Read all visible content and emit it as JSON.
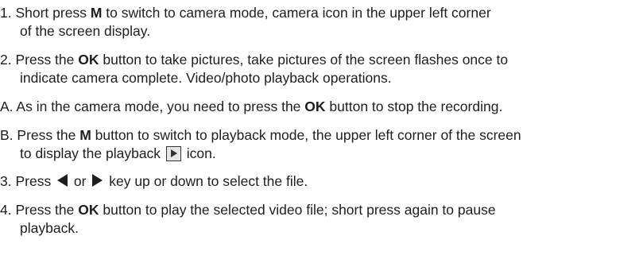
{
  "items": [
    {
      "line1": "1. Short press ",
      "key": "M",
      "line1_rest": " to switch to camera mode, camera icon in the upper left corner",
      "line2": "of the screen display."
    },
    {
      "line1": "2. Press the ",
      "key": "OK",
      "line1_rest": " button to take pictures, take pictures of the screen flashes once to",
      "line2": "indicate camera complete. Video/photo playback operations."
    },
    {
      "line1": "A. As in the camera mode, you need to press the ",
      "key": "OK",
      "line1_rest": " button to stop the recording."
    },
    {
      "line1": "B. Press the ",
      "key": "M",
      "line1_rest": " button to switch to playback mode, the upper left corner of the screen",
      "line2_a": "to display the playback ",
      "line2_b": " icon.",
      "icon": "play-button-icon"
    },
    {
      "line1": "3. Press ",
      "mid": " or ",
      "line1_rest": " key up or down to select the file.",
      "icon_left": "left-arrow-icon",
      "icon_right": "right-arrow-icon"
    },
    {
      "line1": "4. Press the ",
      "key": "OK",
      "line1_rest": " button to play the selected video file; short press again to pause",
      "line2": "playback."
    }
  ]
}
